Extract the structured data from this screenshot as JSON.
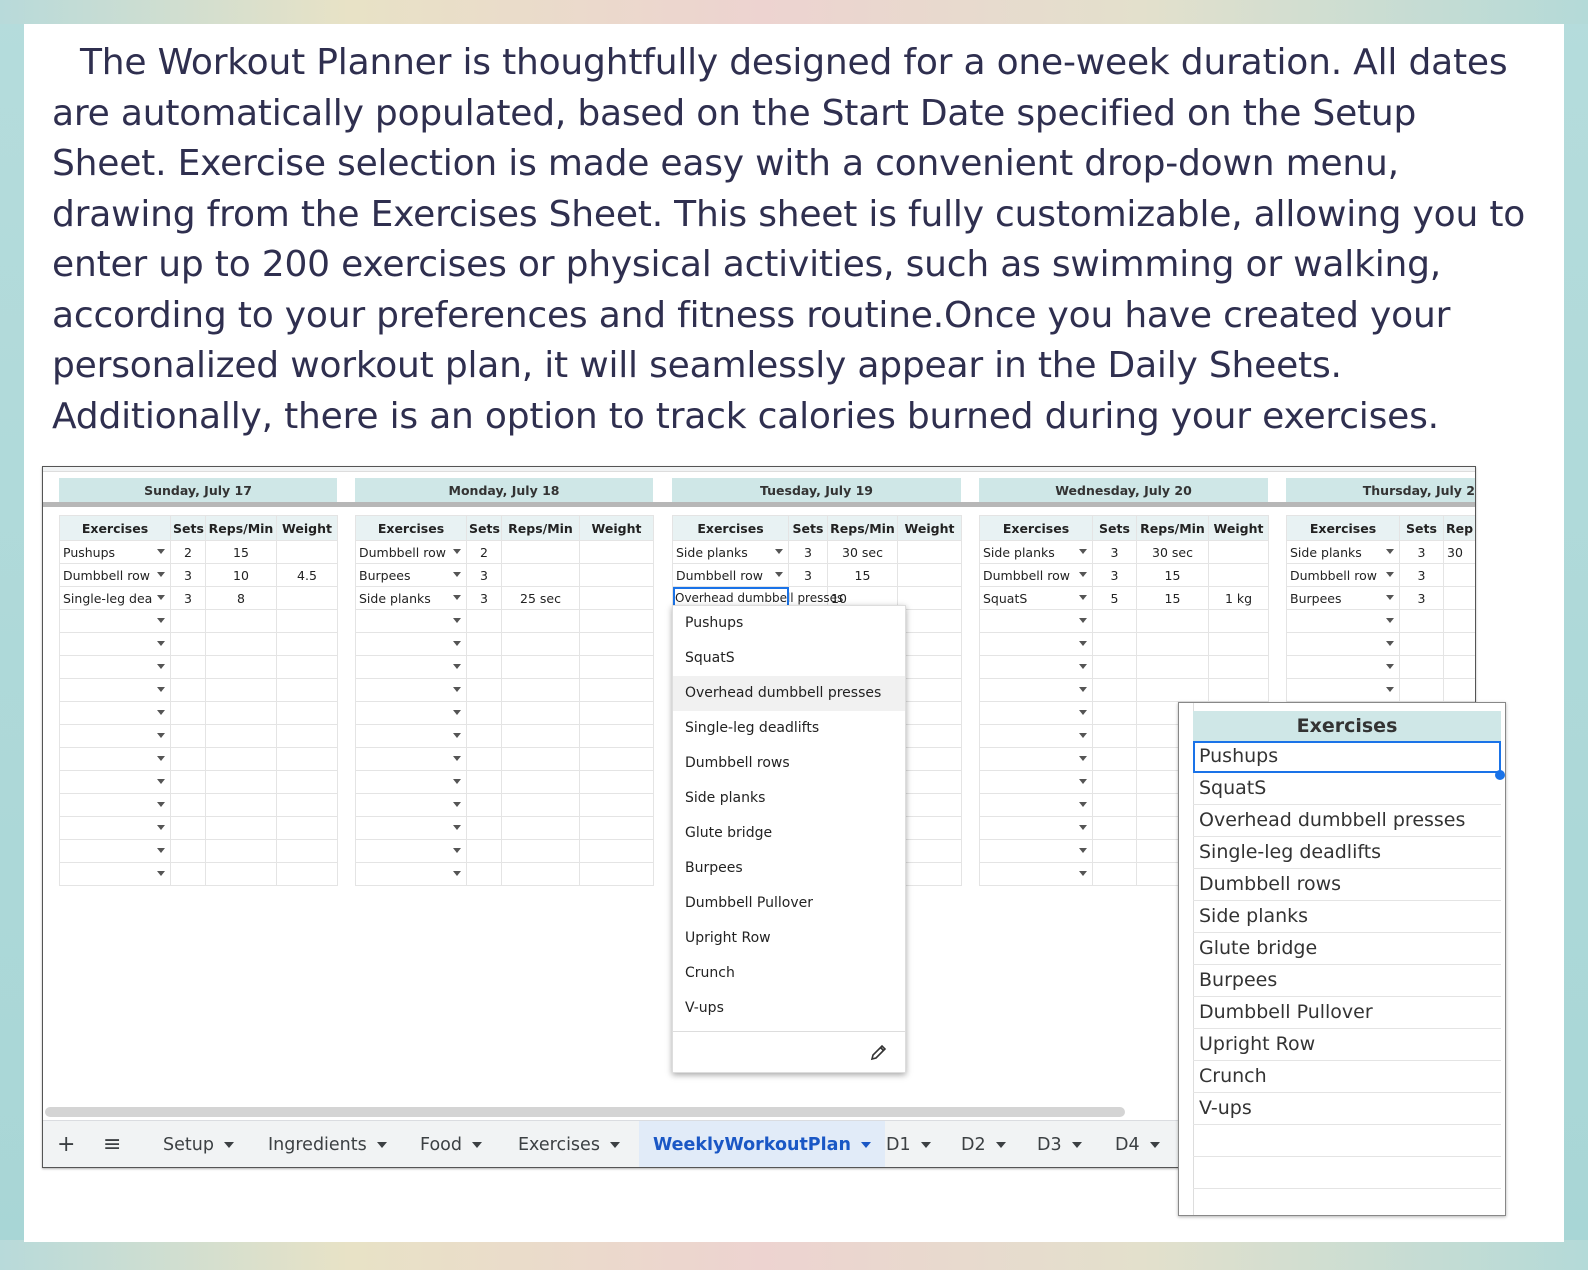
{
  "intro_text": "The Workout Planner is thoughtfully designed for a one-week duration. All dates are automatically populated, based on the Start Date specified on the Setup Sheet. Exercise selection is made easy with a convenient drop-down menu, drawing from the Exercises Sheet. This sheet is fully customizable, allowing you to enter up to 200 exercises or physical activities, such as swimming or walking, according to your preferences and fitness routine.Once you have created your personalized workout plan, it will seamlessly appear in the Daily Sheets. Additionally, there is an option to track calories burned during your exercises.",
  "columns": [
    "Exercises",
    "Sets",
    "Reps/Min",
    "Weight"
  ],
  "days": [
    {
      "title": "Sunday, July 17",
      "rows": [
        {
          "exercise": "Pushups",
          "sets": "2",
          "reps": "15",
          "weight": ""
        },
        {
          "exercise": "Dumbbell row",
          "sets": "3",
          "reps": "10",
          "weight": "4.5"
        },
        {
          "exercise": "Single-leg dea",
          "sets": "3",
          "reps": "8",
          "weight": ""
        }
      ]
    },
    {
      "title": "Monday, July 18",
      "rows": [
        {
          "exercise": "Dumbbell row",
          "sets": "2",
          "reps": "",
          "weight": ""
        },
        {
          "exercise": "Burpees",
          "sets": "3",
          "reps": "",
          "weight": ""
        },
        {
          "exercise": "Side planks",
          "sets": "3",
          "reps": "25 sec",
          "weight": ""
        }
      ]
    },
    {
      "title": "Tuesday, July 19",
      "rows": [
        {
          "exercise": "Side planks",
          "sets": "3",
          "reps": "30 sec",
          "weight": ""
        },
        {
          "exercise": "Dumbbell row",
          "sets": "3",
          "reps": "15",
          "weight": ""
        },
        {
          "exercise": "Overhead dumbbell presses",
          "sets": "",
          "reps": "10",
          "weight": ""
        }
      ]
    },
    {
      "title": "Wednesday, July 20",
      "rows": [
        {
          "exercise": "Side planks",
          "sets": "3",
          "reps": "30 sec",
          "weight": ""
        },
        {
          "exercise": "Dumbbell row",
          "sets": "3",
          "reps": "15",
          "weight": ""
        },
        {
          "exercise": "SquatS",
          "sets": "5",
          "reps": "15",
          "weight": "1 kg"
        }
      ]
    },
    {
      "title": "Thursday, July 2",
      "rows": [
        {
          "exercise": "Side planks",
          "sets": "3",
          "reps": "30",
          "weight": ""
        },
        {
          "exercise": "Dumbbell row",
          "sets": "3",
          "reps": "",
          "weight": ""
        },
        {
          "exercise": "Burpees",
          "sets": "3",
          "reps": "",
          "weight": ""
        }
      ]
    }
  ],
  "thursday_reps_header": "Rep",
  "dropdown_options": [
    "Pushups",
    "SquatS",
    "Overhead dumbbell presses",
    "Single-leg deadlifts",
    "Dumbbell rows",
    "Side planks",
    "Glute bridge",
    "Burpees",
    "Dumbbell Pullover",
    "Upright Row",
    "Crunch",
    "V-ups"
  ],
  "dropdown_highlighted": "Overhead dumbbell presses",
  "tabs": {
    "add": "+",
    "menu": "≡",
    "items": [
      "Setup",
      "Ingredients",
      "Food",
      "Exercises",
      "WeeklyWorkoutPlan",
      "D1",
      "D2",
      "D3",
      "D4"
    ],
    "active": "WeeklyWorkoutPlan"
  },
  "exercises_sheet": {
    "header": "Exercises",
    "items": [
      "Pushups",
      "SquatS",
      "Overhead dumbbell presses",
      "Single-leg deadlifts",
      "Dumbbell rows",
      "Side planks",
      "Glute bridge",
      "Burpees",
      "Dumbbell Pullover",
      "Upright Row",
      "Crunch",
      "V-ups"
    ]
  },
  "colors": {
    "header_teal": "#cfe7e7",
    "accent_blue": "#1a73e8",
    "text_dark": "#2f2f4f"
  },
  "icons": {
    "pencil": "pencil-icon",
    "caret": "chevron-down-icon"
  }
}
